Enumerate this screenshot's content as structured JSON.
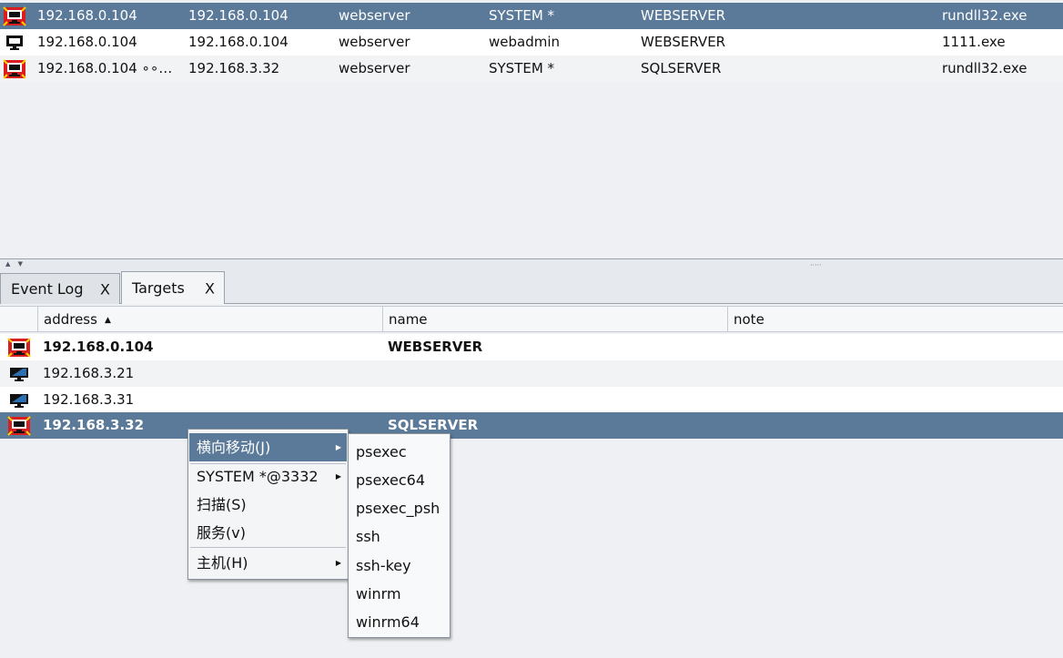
{
  "sessions": {
    "rows": [
      {
        "icon": "red-target-monitor-icon",
        "external": "192.168.0.104",
        "internal": "192.168.0.104",
        "listener": "webserver",
        "user": "SYSTEM *",
        "computer": "WEBSERVER",
        "process": "rundll32.exe"
      },
      {
        "icon": "monitor-icon",
        "external": "192.168.0.104",
        "internal": "192.168.0.104",
        "listener": "webserver",
        "user": "webadmin",
        "computer": "WEBSERVER",
        "process": "1111.exe"
      },
      {
        "icon": "red-target-monitor-icon",
        "external": "192.168.0.104 ∘∘…",
        "internal": "192.168.3.32",
        "listener": "webserver",
        "user": "SYSTEM *",
        "computer": "SQLSERVER",
        "process": "rundll32.exe"
      }
    ]
  },
  "divider": {
    "arrows": "▲ ▼",
    "grip": "·····"
  },
  "tabs": [
    {
      "label": "Event Log",
      "close": "X"
    },
    {
      "label": "Targets",
      "close": "X"
    }
  ],
  "targets": {
    "columns": {
      "address": "address",
      "name": "name",
      "note": "note",
      "sort_indicator": "▲"
    },
    "rows": [
      {
        "icon": "red-target-monitor-icon",
        "address": "192.168.0.104",
        "name": "WEBSERVER",
        "note": ""
      },
      {
        "icon": "monitor-icon",
        "address": "192.168.3.21",
        "name": "",
        "note": ""
      },
      {
        "icon": "monitor-icon",
        "address": "192.168.3.31",
        "name": "",
        "note": ""
      },
      {
        "icon": "red-target-monitor-icon",
        "address": "192.168.3.32",
        "name": "SQLSERVER",
        "note": ""
      }
    ]
  },
  "context_menu": {
    "items": [
      {
        "label": "横向移动(J)",
        "submenu_arrow": "▶"
      },
      {
        "label": "SYSTEM *@3332",
        "submenu_arrow": "▶"
      },
      {
        "label": "扫描(S)"
      },
      {
        "label": "服务(v)"
      },
      {
        "label": "主机(H)",
        "submenu_arrow": "▶"
      }
    ]
  },
  "submenu": {
    "items": [
      "psexec",
      "psexec64",
      "psexec_psh",
      "ssh",
      "ssh-key",
      "winrm",
      "winrm64"
    ]
  },
  "colors": {
    "selection": "#5b7a99",
    "target_red": "#d81e1e"
  }
}
